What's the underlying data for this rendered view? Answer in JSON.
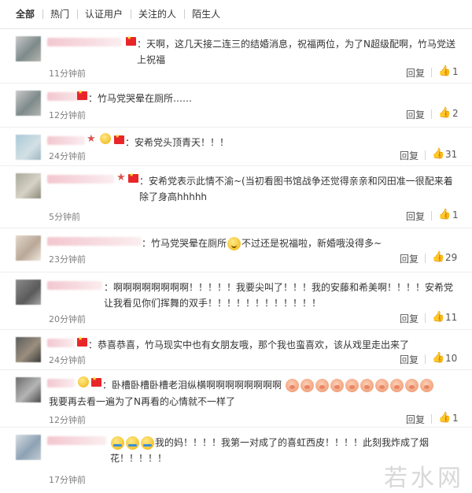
{
  "tabs": [
    {
      "label": "全部"
    },
    {
      "label": "热门"
    },
    {
      "label": "认证用户"
    },
    {
      "label": "关注的人"
    },
    {
      "label": "陌生人"
    }
  ],
  "comments": [
    {
      "text": "：天啊，这几天接二连三的结婚消息，祝福两位，为了N超级配啊，竹马党送上祝福",
      "time": "11分钟前",
      "reply": "回复",
      "likes": "1"
    },
    {
      "text": "：竹马党哭晕在厕所……",
      "time": "12分钟前",
      "reply": "回复",
      "likes": "2"
    },
    {
      "text": "：安希党头顶青天！！！",
      "time": "24分钟前",
      "reply": "回复",
      "likes": "31"
    },
    {
      "text": "：安希党表示此情不渝~(当初看图书馆战争还觉得亲亲和冈田准一很配来着除了身高hhhhh",
      "time": "5分钟前",
      "reply": "回复",
      "likes": "1"
    },
    {
      "text_before": "：竹马党哭晕在厕所",
      "text_after": "不过还是祝福啦，新婚哦没得多~",
      "time": "23分钟前",
      "reply": "回复",
      "likes": "29"
    },
    {
      "text": "：啊啊啊啊啊啊啊啊！！！！！我要尖叫了！！！我的安藤和希美啊！！！！安希党让我看见你们挥舞的双手！！！！！！！！！！！！",
      "time": "20分钟前",
      "reply": "回复",
      "likes": "11"
    },
    {
      "text": "：恭喜恭喜，竹马现实中也有女朋友哦，那个我也蛮喜欢，该从戏里走出来了",
      "time": "24分钟前",
      "reply": "回复",
      "likes": "10"
    },
    {
      "text_first": "：卧槽卧槽卧槽老泪纵横啊啊啊啊啊啊啊啊",
      "text_second": "我要再去看一遍为了N再看的心情就不一样了",
      "time": "12分钟前",
      "reply": "回复",
      "likes": "1"
    },
    {
      "text_after": "我的妈！！！！我第一对成了的喜虹西皮！！！！此刻我炸成了烟花！！！！！",
      "time": "17分钟前"
    }
  ],
  "watermark": "若水网",
  "icons": {
    "like": "thumbs-up-icon",
    "flag": "china-flag-icon",
    "emoji_pig": "pig-emoji-icon",
    "emoji_cry": "crying-emoji-icon",
    "emoji_think": "thinking-emoji-icon"
  }
}
